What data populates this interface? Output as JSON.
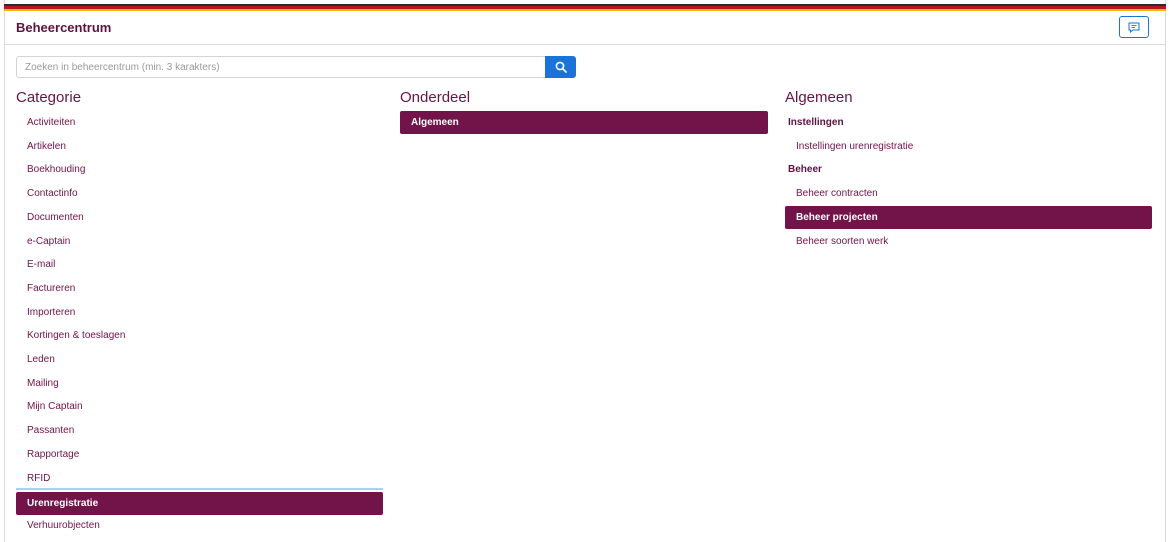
{
  "header": {
    "title": "Beheercentrum",
    "feedback_icon": "message-icon"
  },
  "search": {
    "placeholder": "Zoeken in beheercentrum (min. 3 karakters)",
    "value": "",
    "icon": "search-icon"
  },
  "colors": {
    "brand": "#72134a",
    "accent": "#1a73d9"
  },
  "categorie": {
    "title": "Categorie",
    "items": [
      "Activiteiten",
      "Artikelen",
      "Boekhouding",
      "Contactinfo",
      "Documenten",
      "e-Captain",
      "E-mail",
      "Factureren",
      "Importeren",
      "Kortingen & toeslagen",
      "Leden",
      "Mailing",
      "Mijn Captain",
      "Passanten",
      "Rapportage",
      "RFID",
      "Urenregistratie",
      "Verhuurobjecten"
    ],
    "selected": "Urenregistratie"
  },
  "onderdeel": {
    "title": "Onderdeel",
    "items": [
      "Algemeen"
    ],
    "selected": "Algemeen"
  },
  "algemeen": {
    "title": "Algemeen",
    "groups": [
      {
        "header": "Instellingen",
        "items": [
          "Instellingen urenregistratie"
        ]
      },
      {
        "header": "Beheer",
        "items": [
          "Beheer contracten",
          "Beheer projecten",
          "Beheer soorten werk"
        ]
      }
    ],
    "selected": "Beheer projecten"
  }
}
